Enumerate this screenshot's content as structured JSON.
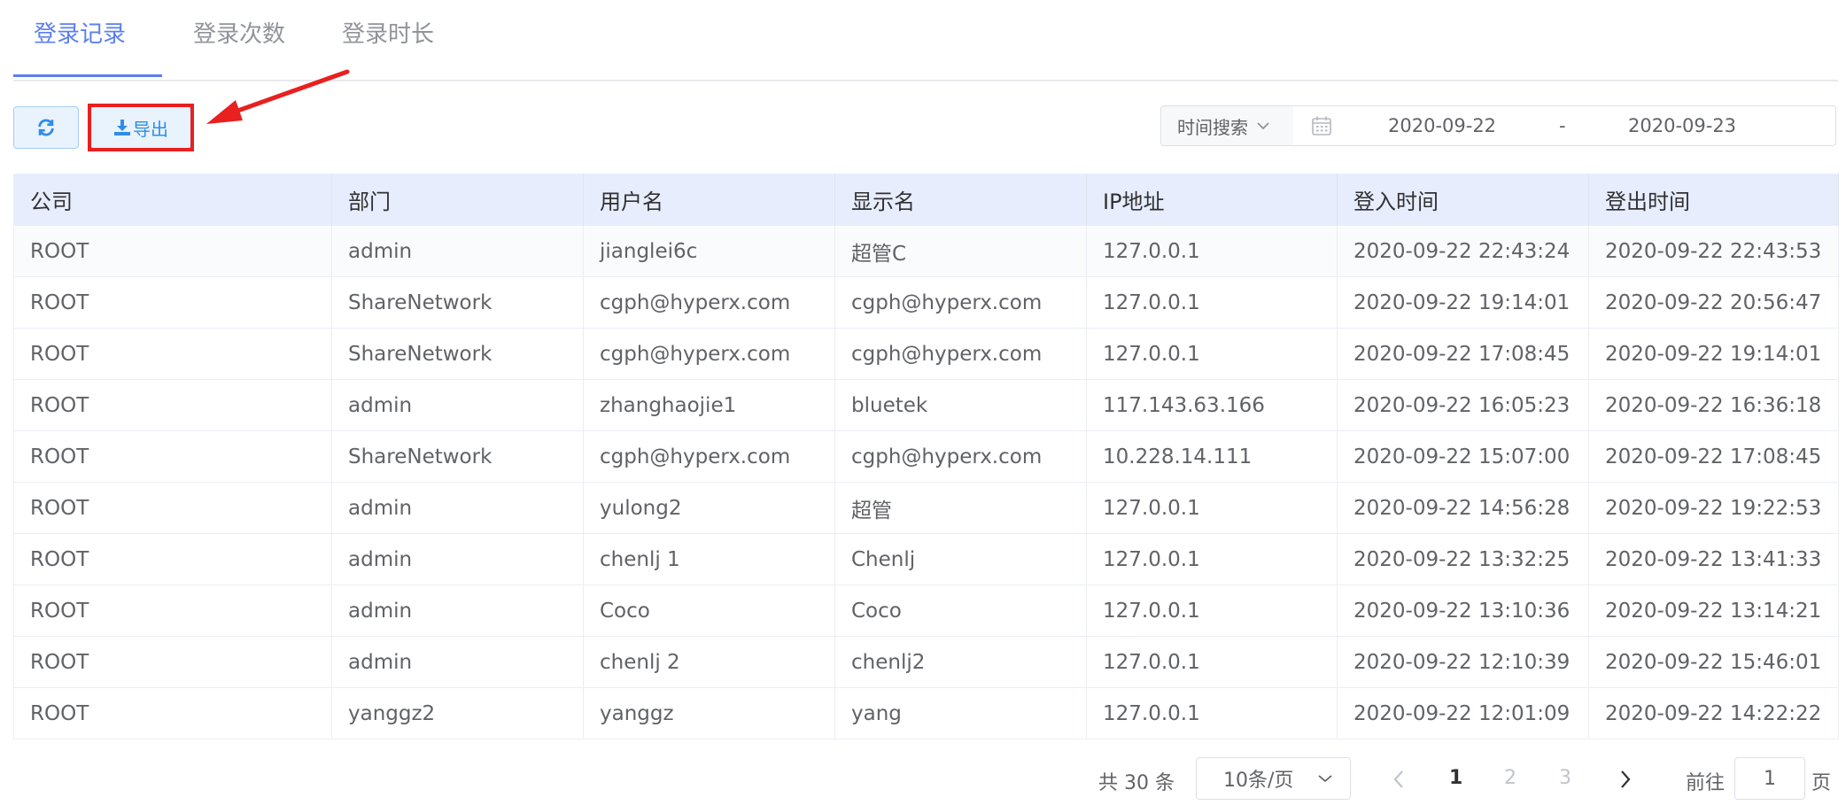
{
  "tabs": [
    {
      "label": "登录记录",
      "active": true
    },
    {
      "label": "登录次数",
      "active": false
    },
    {
      "label": "登录时长",
      "active": false
    }
  ],
  "toolbar": {
    "refresh_icon": "refresh-icon",
    "export_icon": "download-icon",
    "export_label": "导出"
  },
  "search": {
    "type_label": "时间搜索",
    "start_date": "2020-09-22",
    "separator": "-",
    "end_date": "2020-09-23"
  },
  "table": {
    "columns": [
      "公司",
      "部门",
      "用户名",
      "显示名",
      "IP地址",
      "登入时间",
      "登出时间"
    ],
    "rows": [
      [
        "ROOT",
        "admin",
        "jianglei6c",
        "超管C",
        "127.0.0.1",
        "2020-09-22 22:43:24",
        "2020-09-22 22:43:53"
      ],
      [
        "ROOT",
        "ShareNetwork",
        "cgph@hyperx.com",
        "cgph@hyperx.com",
        "127.0.0.1",
        "2020-09-22 19:14:01",
        "2020-09-22 20:56:47"
      ],
      [
        "ROOT",
        "ShareNetwork",
        "cgph@hyperx.com",
        "cgph@hyperx.com",
        "127.0.0.1",
        "2020-09-22 17:08:45",
        "2020-09-22 19:14:01"
      ],
      [
        "ROOT",
        "admin",
        "zhanghaojie1",
        "bluetek",
        "117.143.63.166",
        "2020-09-22 16:05:23",
        "2020-09-22 16:36:18"
      ],
      [
        "ROOT",
        "ShareNetwork",
        "cgph@hyperx.com",
        "cgph@hyperx.com",
        "10.228.14.111",
        "2020-09-22 15:07:00",
        "2020-09-22 17:08:45"
      ],
      [
        "ROOT",
        "admin",
        "yulong2",
        "超管",
        "127.0.0.1",
        "2020-09-22 14:56:28",
        "2020-09-22 19:22:53"
      ],
      [
        "ROOT",
        "admin",
        "chenlj 1",
        "Chenlj",
        "127.0.0.1",
        "2020-09-22 13:32:25",
        "2020-09-22 13:41:33"
      ],
      [
        "ROOT",
        "admin",
        "Coco",
        "Coco",
        "127.0.0.1",
        "2020-09-22 13:10:36",
        "2020-09-22 13:14:21"
      ],
      [
        "ROOT",
        "admin",
        "chenlj 2",
        "chenlj2",
        "127.0.0.1",
        "2020-09-22 12:10:39",
        "2020-09-22 15:46:01"
      ],
      [
        "ROOT",
        "yanggz2",
        "yanggz",
        "yang",
        "127.0.0.1",
        "2020-09-22 12:01:09",
        "2020-09-22 14:22:22"
      ]
    ]
  },
  "pagination": {
    "total_text": "共 30 条",
    "page_size": "10条/页",
    "pages": [
      "1",
      "2",
      "3"
    ],
    "current_page": "1",
    "goto_prefix": "前往",
    "goto_value": "1",
    "goto_suffix": "页"
  },
  "colors": {
    "accent": "#5b7ff0",
    "header_bg": "#e7edfc",
    "highlight": "#e82020"
  }
}
